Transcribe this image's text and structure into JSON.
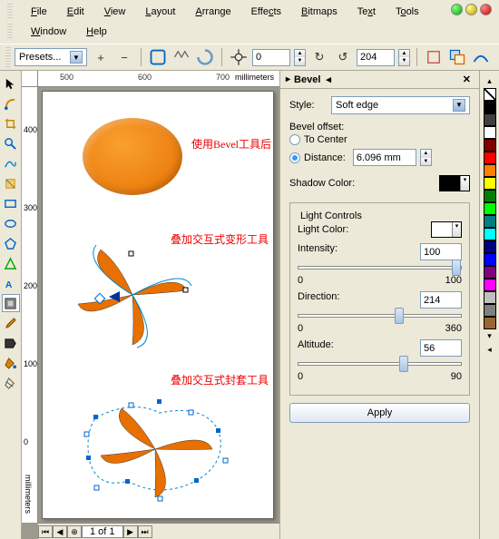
{
  "menu": {
    "row1": [
      {
        "label": "File",
        "u": "F"
      },
      {
        "label": "Edit",
        "u": "E"
      },
      {
        "label": "View",
        "u": "V"
      },
      {
        "label": "Layout",
        "u": "L"
      },
      {
        "label": "Arrange",
        "u": "A"
      },
      {
        "label": "Effects",
        "u": "s"
      },
      {
        "label": "Bitmaps",
        "u": "B"
      },
      {
        "label": "Text",
        "u": "x"
      },
      {
        "label": "Tools",
        "u": "o"
      }
    ],
    "row2": [
      {
        "label": "Window",
        "u": "W"
      },
      {
        "label": "Help",
        "u": "H"
      }
    ]
  },
  "toolbar": {
    "preset_label": "Presets...",
    "rotation": "0",
    "value2": "204"
  },
  "ruler": {
    "h_ticks": [
      "500",
      "600",
      "700"
    ],
    "h_unit": "millimeters",
    "v_ticks": [
      "400",
      "300",
      "200",
      "100",
      "0"
    ],
    "v_unit": "millimeters"
  },
  "canvas": {
    "anno1": "使用Bevel工具后",
    "anno2": "叠加交互式变形工具",
    "anno3": "叠加交互式封套工具"
  },
  "pagenav": {
    "label": "1 of 1"
  },
  "docker": {
    "title": "Bevel",
    "style_label": "Style:",
    "style_value": "Soft edge",
    "offset_label": "Bevel offset:",
    "radio_tocenter": "To Center",
    "radio_distance": "Distance:",
    "distance_value": "6.096 mm",
    "shadow_label": "Shadow Color:",
    "shadow_color": "#000000",
    "light_group": "Light Controls",
    "lightcolor_label": "Light Color:",
    "lightcolor_value": "#ffffff",
    "intensity_label": "Intensity:",
    "intensity_value": "100",
    "intensity_min": "0",
    "intensity_max": "100",
    "direction_label": "Direction:",
    "direction_value": "214",
    "direction_min": "0",
    "direction_max": "360",
    "altitude_label": "Altitude:",
    "altitude_value": "56",
    "altitude_min": "0",
    "altitude_max": "90",
    "apply": "Apply"
  },
  "colors": [
    "#000000",
    "#404040",
    "#ffffff",
    "#800000",
    "#ff0000",
    "#ff8000",
    "#ffff00",
    "#008000",
    "#00ff00",
    "#008080",
    "#00ffff",
    "#000080",
    "#0000ff",
    "#800080",
    "#ff00ff",
    "#c0c0c0",
    "#808080",
    "#996633"
  ],
  "watermark": ""
}
